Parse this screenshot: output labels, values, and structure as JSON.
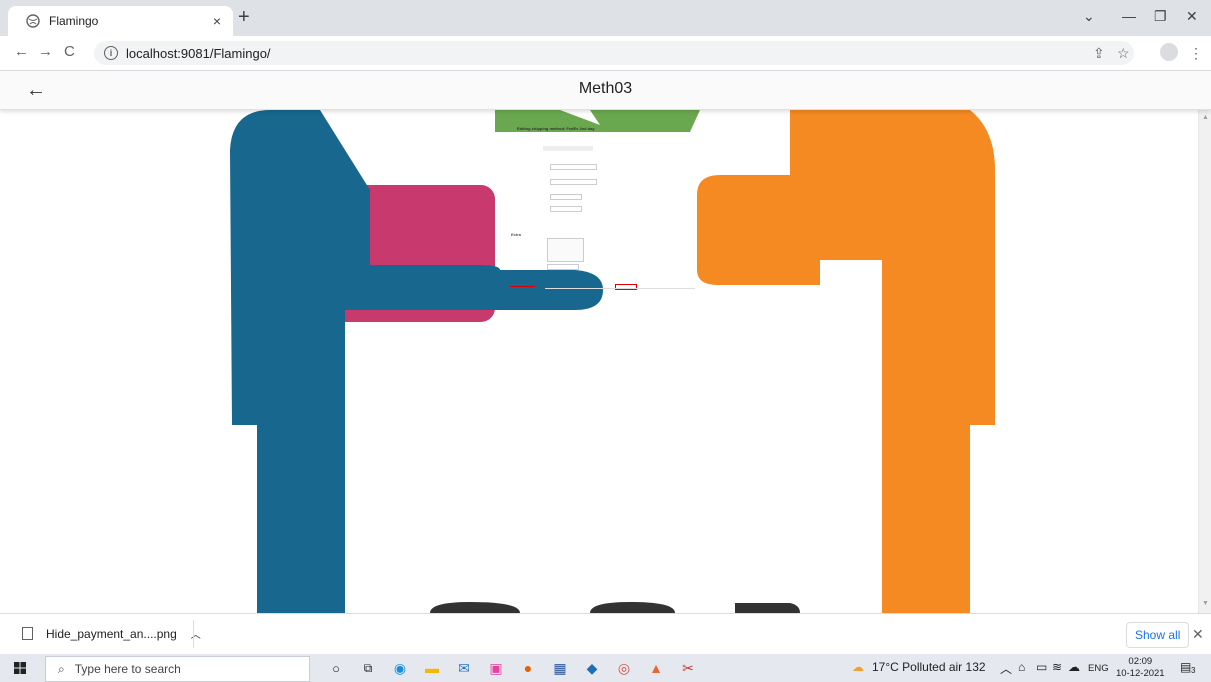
{
  "browser": {
    "tab_title": "Flamingo",
    "tab_close": "×",
    "new_tab": "+",
    "url": "localhost:9081/Flamingo/"
  },
  "app": {
    "title": "Meth03"
  },
  "content": {
    "mini_header": "Editing shipping method: FedEx 2nd day",
    "mini_extra": "Extra",
    "bottom_letters": "COD"
  },
  "download": {
    "filename": "Hide_payment_an....png",
    "show_all": "Show all"
  },
  "taskbar": {
    "search_placeholder": "Type here to search",
    "weather": "17°C  Polluted air 132",
    "language": "ENG",
    "time": "02:09",
    "date": "10-12-2021",
    "notification_count": "3"
  }
}
